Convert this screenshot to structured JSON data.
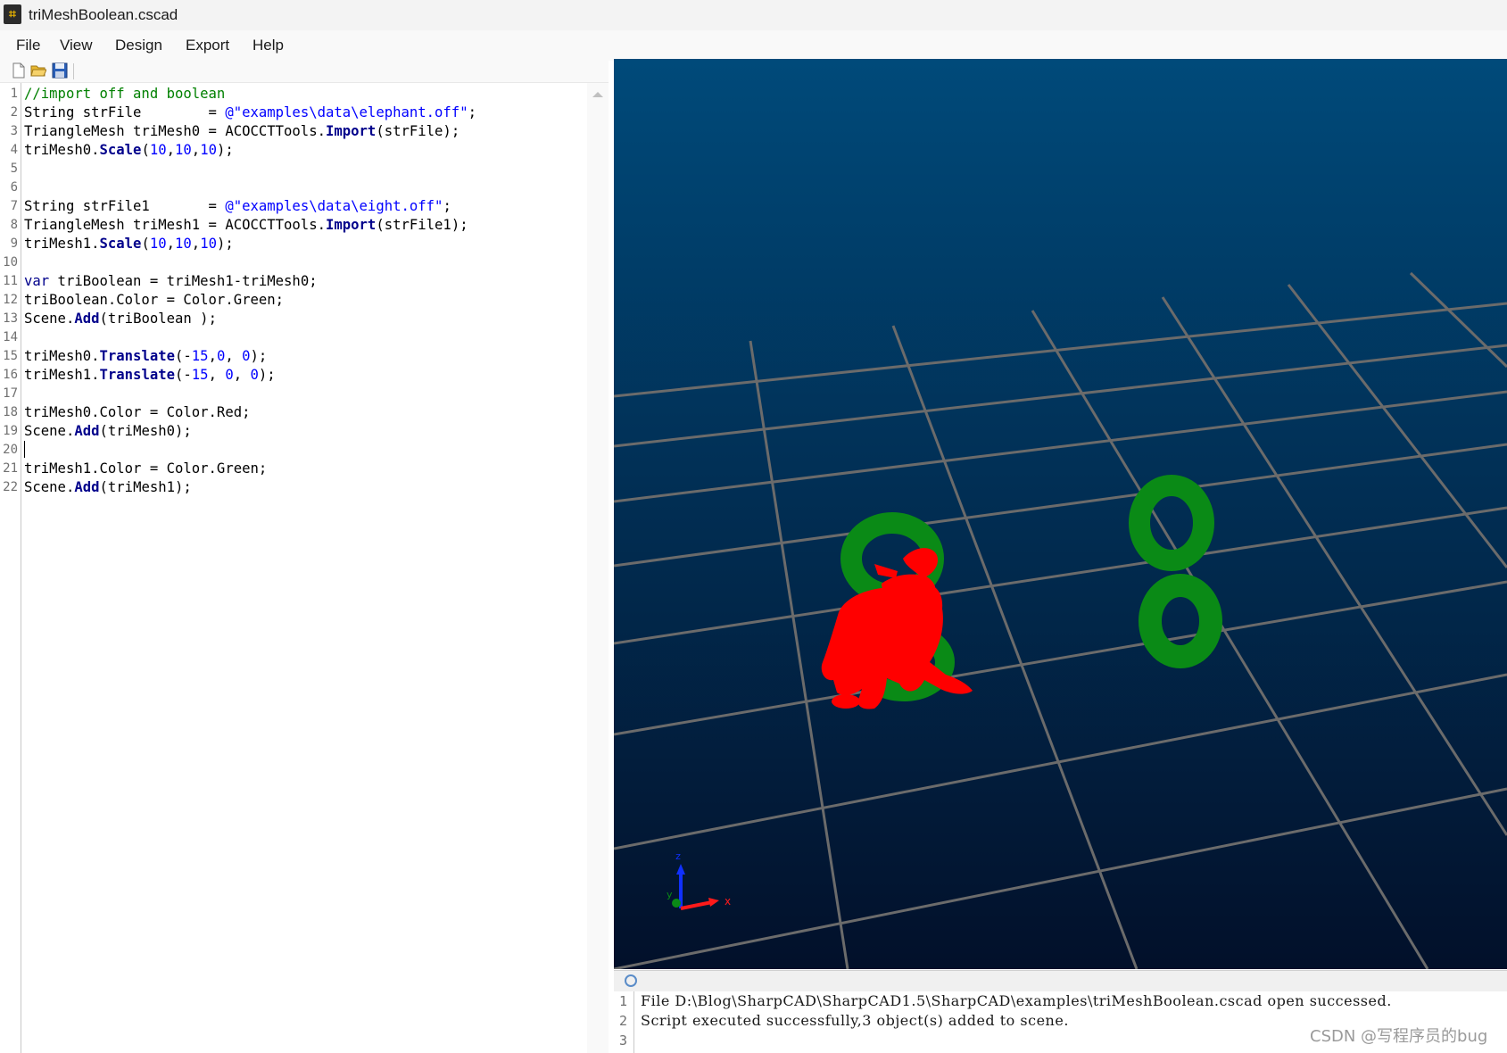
{
  "window": {
    "title": "triMeshBoolean.cscad",
    "icon": "app-icon"
  },
  "menu": [
    "File",
    "View",
    "Design",
    "Export",
    "Help"
  ],
  "toolbar": {
    "buttons": [
      "new-file-icon",
      "open-folder-icon",
      "save-icon"
    ]
  },
  "editor": {
    "line_numbers": [
      "1",
      "2",
      "3",
      "4",
      "5",
      "6",
      "7",
      "8",
      "9",
      "10",
      "11",
      "12",
      "13",
      "14",
      "15",
      "16",
      "17",
      "18",
      "19",
      "20",
      "21",
      "22"
    ],
    "lines": [
      [
        {
          "t": "//import off and boolean",
          "c": "cm"
        }
      ],
      [
        {
          "t": "String strFile        = ",
          "c": ""
        },
        {
          "t": "@\"examples\\data\\elephant.off\"",
          "c": "st"
        },
        {
          "t": ";",
          "c": ""
        }
      ],
      [
        {
          "t": "TriangleMesh triMesh0 = ACOCCTTools.",
          "c": ""
        },
        {
          "t": "Import",
          "c": "fn"
        },
        {
          "t": "(strFile);",
          "c": ""
        }
      ],
      [
        {
          "t": "triMesh0.",
          "c": ""
        },
        {
          "t": "Scale",
          "c": "fn"
        },
        {
          "t": "(",
          "c": ""
        },
        {
          "t": "10",
          "c": "nm"
        },
        {
          "t": ",",
          "c": ""
        },
        {
          "t": "10",
          "c": "nm"
        },
        {
          "t": ",",
          "c": ""
        },
        {
          "t": "10",
          "c": "nm"
        },
        {
          "t": ");",
          "c": ""
        }
      ],
      [],
      [],
      [
        {
          "t": "String strFile1       = ",
          "c": ""
        },
        {
          "t": "@\"examples\\data\\eight.off\"",
          "c": "st"
        },
        {
          "t": ";",
          "c": ""
        }
      ],
      [
        {
          "t": "TriangleMesh triMesh1 = ACOCCTTools.",
          "c": ""
        },
        {
          "t": "Import",
          "c": "fn"
        },
        {
          "t": "(strFile1);",
          "c": ""
        }
      ],
      [
        {
          "t": "triMesh1.",
          "c": ""
        },
        {
          "t": "Scale",
          "c": "fn"
        },
        {
          "t": "(",
          "c": ""
        },
        {
          "t": "10",
          "c": "nm"
        },
        {
          "t": ",",
          "c": ""
        },
        {
          "t": "10",
          "c": "nm"
        },
        {
          "t": ",",
          "c": ""
        },
        {
          "t": "10",
          "c": "nm"
        },
        {
          "t": ");",
          "c": ""
        }
      ],
      [],
      [
        {
          "t": "var",
          "c": "kw"
        },
        {
          "t": " triBoolean = triMesh1-triMesh0;",
          "c": ""
        }
      ],
      [
        {
          "t": "triBoolean.Color = Color.Green;",
          "c": ""
        }
      ],
      [
        {
          "t": "Scene.",
          "c": ""
        },
        {
          "t": "Add",
          "c": "fn"
        },
        {
          "t": "(triBoolean );",
          "c": ""
        }
      ],
      [],
      [
        {
          "t": "triMesh0.",
          "c": ""
        },
        {
          "t": "Translate",
          "c": "fn"
        },
        {
          "t": "(-",
          "c": ""
        },
        {
          "t": "15",
          "c": "nm"
        },
        {
          "t": ",",
          "c": ""
        },
        {
          "t": "0",
          "c": "nm"
        },
        {
          "t": ", ",
          "c": ""
        },
        {
          "t": "0",
          "c": "nm"
        },
        {
          "t": ");",
          "c": ""
        }
      ],
      [
        {
          "t": "triMesh1.",
          "c": ""
        },
        {
          "t": "Translate",
          "c": "fn"
        },
        {
          "t": "(-",
          "c": ""
        },
        {
          "t": "15",
          "c": "nm"
        },
        {
          "t": ", ",
          "c": ""
        },
        {
          "t": "0",
          "c": "nm"
        },
        {
          "t": ", ",
          "c": ""
        },
        {
          "t": "0",
          "c": "nm"
        },
        {
          "t": ");",
          "c": ""
        }
      ],
      [],
      [
        {
          "t": "triMesh0.Color = Color.Red;",
          "c": ""
        }
      ],
      [
        {
          "t": "Scene.",
          "c": ""
        },
        {
          "t": "Add",
          "c": "fn"
        },
        {
          "t": "(triMesh0);",
          "c": ""
        }
      ],
      [],
      [
        {
          "t": "triMesh1.Color = Color.Green;",
          "c": ""
        }
      ],
      [
        {
          "t": "Scene.",
          "c": ""
        },
        {
          "t": "Add",
          "c": "fn"
        },
        {
          "t": "(triMesh1);",
          "c": ""
        }
      ]
    ]
  },
  "viewport": {
    "background_top": "#004a7a",
    "background_bottom": "#02102a",
    "grid_color": "#6b6b6b",
    "red_mesh_color": "#ff0000",
    "green_mesh_color": "#0a8a16",
    "axis": {
      "x": "x",
      "y": "y",
      "z": "z"
    }
  },
  "console": {
    "line_numbers": [
      "1",
      "2",
      "3"
    ],
    "lines": [
      "File D:\\Blog\\SharpCAD\\SharpCAD1.5\\SharpCAD\\examples\\triMeshBoolean.cscad open successed.",
      "Script executed successfully,3 object(s) added to scene.",
      ""
    ]
  },
  "watermark": "CSDN @写程序员的bug"
}
